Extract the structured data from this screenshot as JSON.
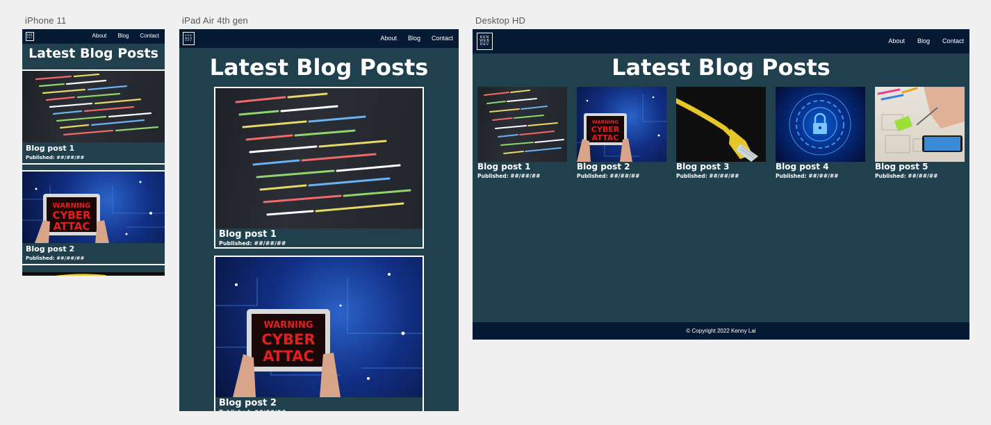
{
  "devices": {
    "phone_label": "iPhone 11",
    "tablet_label": "iPad Air 4th gen",
    "desktop_label": "Desktop HD"
  },
  "site": {
    "logo_lines": [
      "KEN",
      "WEB",
      "DEV"
    ],
    "nav": {
      "about": "About",
      "blog": "Blog",
      "contact": "Contact"
    },
    "heading": "Latest Blog Posts",
    "copyright": "© Copyright 2022 Kenny Lai"
  },
  "posts": [
    {
      "title": "Blog post 1",
      "published": "Published: ##/##/##",
      "image": "code-screen"
    },
    {
      "title": "Blog post 2",
      "published": "Published: ##/##/##",
      "image": "cyber-attack-tablet"
    },
    {
      "title": "Blog post 3",
      "published": "Published: ##/##/##",
      "image": "yellow-ethernet-cable"
    },
    {
      "title": "Blog post 4",
      "published": "Published: ##/##/##",
      "image": "digital-lock"
    },
    {
      "title": "Blog post 5",
      "published": "Published: ##/##/##",
      "image": "hands-wireframe-sketch"
    }
  ],
  "colors": {
    "page_bg": "#21404e",
    "nav_bg": "#061a33",
    "text": "#ffffff",
    "canvas_bg": "#f0f0f0"
  }
}
